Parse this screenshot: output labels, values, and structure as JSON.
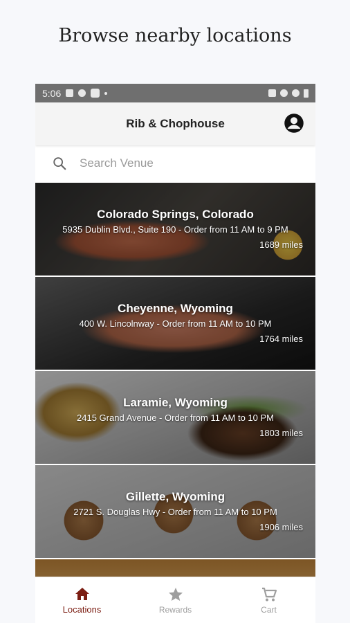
{
  "headline": "Browse nearby locations",
  "status_bar": {
    "time": "5:06"
  },
  "app_bar": {
    "title": "Rib & Chophouse"
  },
  "search": {
    "placeholder": "Search Venue"
  },
  "locations": [
    {
      "city": "Colorado Springs, Colorado",
      "address": "5935 Dublin Blvd., Suite 190",
      "hours": "Order from 11 AM to 9 PM",
      "distance": "1689",
      "unit": "miles"
    },
    {
      "city": "Cheyenne, Wyoming",
      "address": "400 W. Lincolnway",
      "hours": "Order from 11 AM to 10 PM",
      "distance": "1764",
      "unit": "miles"
    },
    {
      "city": "Laramie, Wyoming",
      "address": "2415 Grand Avenue",
      "hours": "Order from 11 AM to 10 PM",
      "distance": "1803",
      "unit": "miles"
    },
    {
      "city": "Gillette, Wyoming",
      "address": "2721 S. Douglas Hwy",
      "hours": "Order from 11 AM to 10 PM",
      "distance": "1906",
      "unit": "miles"
    }
  ],
  "bottom_nav": [
    {
      "label": "Locations",
      "icon": "home-icon",
      "active": true
    },
    {
      "label": "Rewards",
      "icon": "star-icon",
      "active": false
    },
    {
      "label": "Cart",
      "icon": "cart-icon",
      "active": false
    }
  ],
  "colors": {
    "accent": "#7b1d12",
    "status_bar": "#6f6f6f",
    "inactive": "#9e9e9e"
  }
}
